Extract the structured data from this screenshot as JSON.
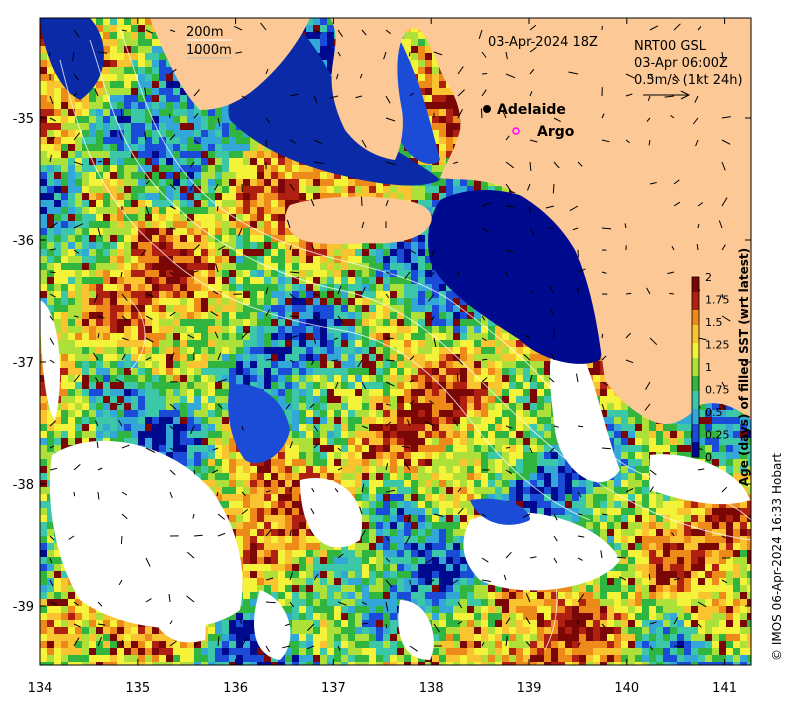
{
  "map": {
    "date_label": "03-Apr-2024 18Z",
    "scale_legend": [
      "200m",
      "1000m"
    ],
    "current_legend": [
      "NRT00 GSL",
      "03-Apr 06:00Z",
      "0.5m/s (1kt 24h)"
    ],
    "markers": [
      {
        "name": "Adelaide",
        "symbol": "filled-black-dot"
      },
      {
        "name": "Argo",
        "symbol": "magenta-open-circle"
      }
    ],
    "credit": "© IMOS 06-Apr-2024 16:33 Hobart"
  },
  "axes": {
    "x_ticks": [
      "134",
      "135",
      "136",
      "137",
      "138",
      "139",
      "140",
      "141"
    ],
    "y_ticks": [
      "-35",
      "-36",
      "-37",
      "-38",
      "-39"
    ]
  },
  "colorbar": {
    "title": "Age (days) of filled SST (wrt latest)",
    "ticks": [
      "0",
      "0.25",
      "0.5",
      "0.75",
      "1",
      "1.25",
      "1.5",
      "1.75",
      "2"
    ],
    "range": [
      0,
      2
    ]
  },
  "colors": {
    "land": "#FCC896",
    "ramp": [
      "#000a8f",
      "#1a4cd8",
      "#33a8d8",
      "#3cc8a8",
      "#2fb540",
      "#aee03a",
      "#f5f23a",
      "#f9c42f",
      "#ee8a1a",
      "#b02010",
      "#7a0606"
    ],
    "nodata": "#ffffff"
  }
}
